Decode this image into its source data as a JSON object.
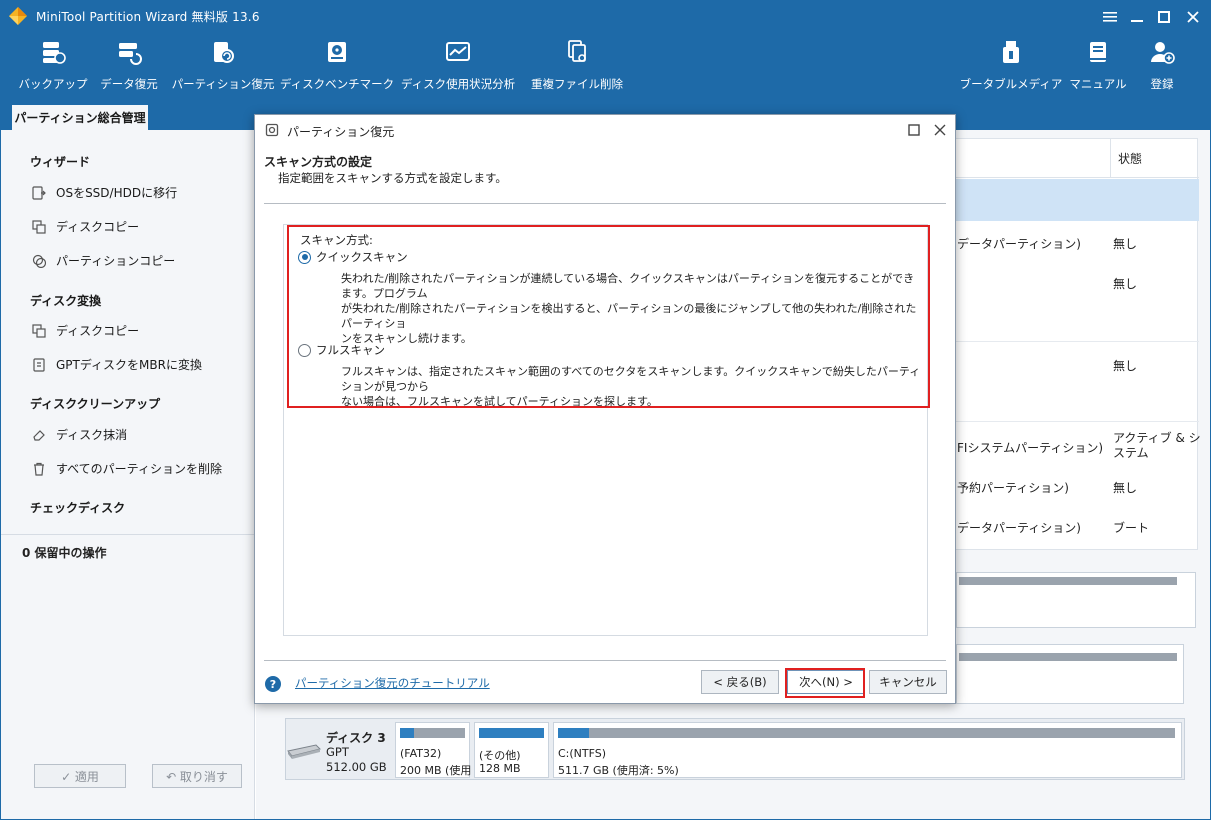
{
  "window": {
    "title": "MiniTool Partition Wizard 無料版 13.6",
    "icons": [
      "menu-icon",
      "minimize-icon",
      "maximize-icon",
      "close-icon"
    ]
  },
  "toolbar": {
    "items": [
      {
        "label": "バックアップ",
        "icon": "backup-icon"
      },
      {
        "label": "データ復元",
        "icon": "data-recovery-icon"
      },
      {
        "label": "パーティション復元",
        "icon": "partition-recovery-icon"
      },
      {
        "label": "ディスクベンチマーク",
        "icon": "disk-benchmark-icon"
      },
      {
        "label": "ディスク使用状況分析",
        "icon": "space-analyzer-icon"
      },
      {
        "label": "重複ファイル削除",
        "icon": "duplicate-file-icon"
      },
      {
        "label": "ブータブルメディア",
        "icon": "bootable-media-icon"
      },
      {
        "label": "マニュアル",
        "icon": "manual-icon"
      },
      {
        "label": "登録",
        "icon": "register-icon"
      }
    ]
  },
  "tab": {
    "label": "パーティション総合管理"
  },
  "sidebar": {
    "sections": [
      {
        "title": "ウィザード",
        "items": [
          {
            "label": "OSをSSD/HDDに移行",
            "icon": "migrate-os-icon"
          },
          {
            "label": "ディスクコピー",
            "icon": "copy-disk-icon"
          },
          {
            "label": "パーティションコピー",
            "icon": "copy-partition-icon"
          }
        ]
      },
      {
        "title": "ディスク変換",
        "items": [
          {
            "label": "ディスクコピー",
            "icon": "copy-disk-icon"
          },
          {
            "label": "GPTディスクをMBRに変換",
            "icon": "convert-disk-icon"
          }
        ]
      },
      {
        "title": "ディスククリーンアップ",
        "items": [
          {
            "label": "ディスク抹消",
            "icon": "wipe-disk-icon"
          },
          {
            "label": "すべてのパーティションを削除",
            "icon": "trash-icon"
          }
        ]
      },
      {
        "title": "チェックディスク",
        "items": []
      }
    ],
    "pending": "0 保留中の操作",
    "apply": "✓ 適用",
    "undo": "↶ 取り消す"
  },
  "table": {
    "state_header": "状態",
    "rows": [
      {
        "type": "データパーティション)",
        "state": "無し"
      },
      {
        "type": "",
        "state": "無し"
      },
      {
        "type": "",
        "state": "無し"
      },
      {
        "type": "FIシステムパーティション)",
        "state": "アクティブ & システム"
      },
      {
        "type": "予約パーティション)",
        "state": "無し"
      },
      {
        "type": "データパーティション)",
        "state": "ブート"
      }
    ]
  },
  "disk3": {
    "name": "ディスク 3",
    "style": "GPT",
    "size": "512.00 GB",
    "partitions": [
      {
        "fs": "(FAT32)",
        "detail": "200 MB (使用",
        "usage": 0.22
      },
      {
        "fs": "(その他)",
        "detail": "128 MB",
        "usage": 1.0
      },
      {
        "fs": "C:(NTFS)",
        "detail": "511.7 GB (使用済: 5%)",
        "usage": 0.05
      }
    ]
  },
  "dialog": {
    "title": "パーティション復元",
    "heading": "スキャン方式の設定",
    "subheading": "指定範囲をスキャンする方式を設定します。",
    "group_label": "スキャン方式:",
    "options": [
      {
        "label": "クイックスキャン",
        "checked": true,
        "desc1": "失われた/削除されたパーティションが連続している場合、クイックスキャンはパーティションを復元することができます。プログラム",
        "desc2": "が失われた/削除されたパーティションを検出すると、パーティションの最後にジャンプして他の失われた/削除されたパーティショ",
        "desc3": "ンをスキャンし続けます。"
      },
      {
        "label": "フルスキャン",
        "checked": false,
        "desc1": "フルスキャンは、指定されたスキャン範囲のすべてのセクタをスキャンします。クイックスキャンで紛失したパーティションが見つから",
        "desc2": "ない場合は、フルスキャンを試してパーティションを探します。",
        "desc3": ""
      }
    ],
    "tutorial_link": "パーティション復元のチュートリアル",
    "back": "< 戻る(B)",
    "next": "次へ(N) >",
    "cancel": "キャンセル"
  },
  "colors": {
    "brand": "#1e6aa8",
    "highlight": "#e02020",
    "selected_row": "#cfe3f6"
  }
}
